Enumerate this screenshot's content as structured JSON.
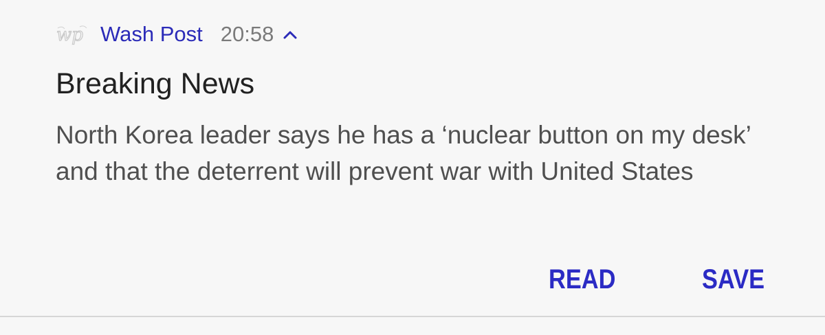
{
  "notification": {
    "app_name": "Wash Post",
    "time": "20:58",
    "app_icon": "washington-post-logo",
    "chevron_icon": "chevron-up-icon",
    "title": "Breaking News",
    "body": "North Korea leader says he has a ‘nuclear button on my desk’ and that the deterrent will prevent war with United States",
    "actions": {
      "read_label": "READ",
      "save_label": "SAVE"
    },
    "colors": {
      "accent": "#2b2bc4",
      "background": "#f7f7f7",
      "title": "#212121",
      "body": "#4f4f4f",
      "timestamp": "#7a7a7a"
    }
  }
}
